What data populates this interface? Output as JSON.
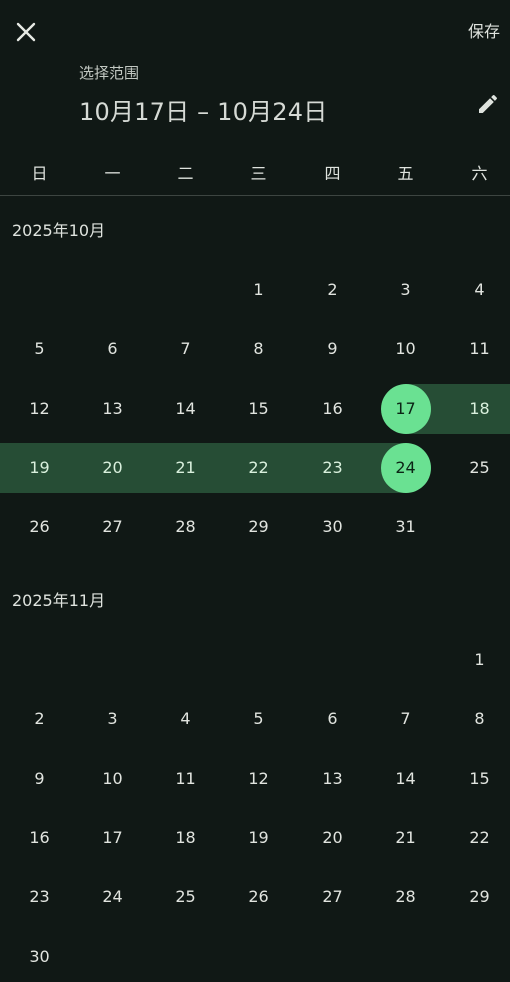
{
  "toolbar": {
    "close_icon": "close-icon",
    "save_label": "保存"
  },
  "header": {
    "label": "选择范围",
    "range": "10月17日 – 10月24日",
    "edit_icon": "pencil-icon"
  },
  "weekdays": [
    "日",
    "一",
    "二",
    "三",
    "四",
    "五",
    "六"
  ],
  "colors": {
    "background": "#101815",
    "range_band": "#264d35",
    "endpoint": "#6ae192",
    "divider": "#3d4541"
  },
  "selection": {
    "start": {
      "month_index": 0,
      "day": 17
    },
    "end": {
      "month_index": 0,
      "day": 24
    }
  },
  "months": [
    {
      "label": "2025年10月",
      "first_weekday": 3,
      "days": 31
    },
    {
      "label": "2025年11月",
      "first_weekday": 6,
      "days": 30
    }
  ]
}
